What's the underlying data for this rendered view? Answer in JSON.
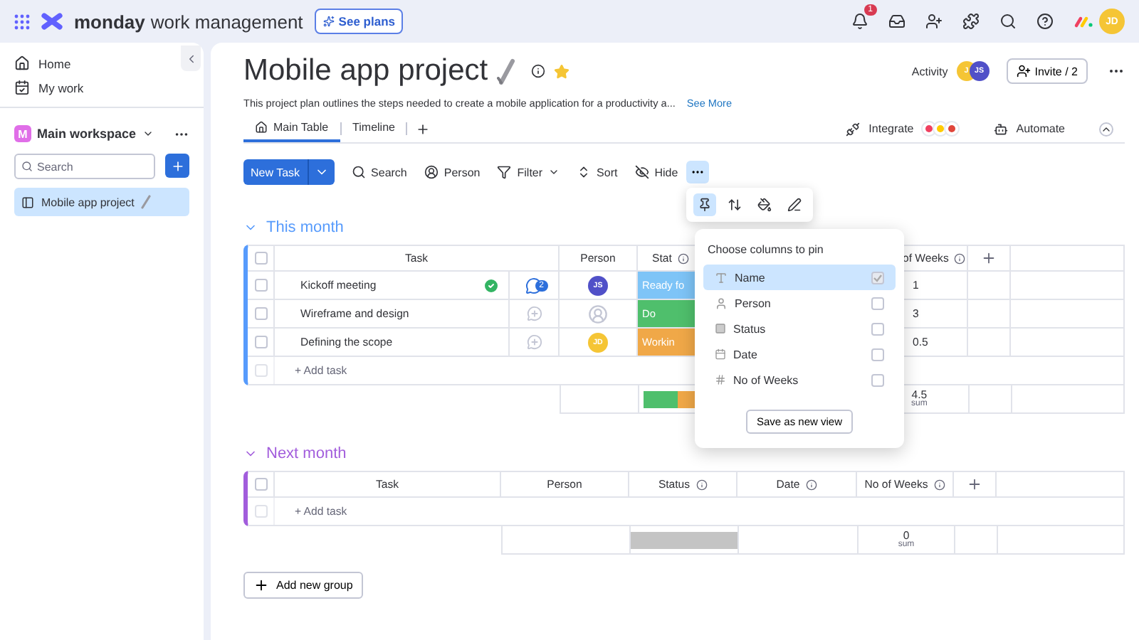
{
  "topbar": {
    "brand": "monday",
    "product": "work management",
    "see_plans": "See plans",
    "notification_count": "1",
    "avatar": "JD"
  },
  "sidebar": {
    "nav": [
      {
        "label": "Home",
        "kind": "home"
      },
      {
        "label": "My work",
        "kind": "work"
      }
    ],
    "workspace": {
      "badge": "M",
      "name": "Main workspace"
    },
    "search": {
      "placeholder": "Search"
    },
    "boards": [
      {
        "label": "Mobile app project",
        "selected": true
      }
    ]
  },
  "board": {
    "title": "Mobile app project",
    "description": "This project plan outlines the steps needed to create a mobile application for a productivity a...",
    "see_more": "See More",
    "activity": "Activity",
    "activity_avatars": [
      {
        "initials": "J",
        "color": "#f5c535"
      },
      {
        "initials": "JS",
        "color": "#5050c8"
      }
    ],
    "invite": "Invite / 2",
    "views": [
      {
        "label": "Main Table",
        "selected": true
      },
      {
        "label": "Timeline",
        "selected": false
      }
    ],
    "integrate": "Integrate",
    "automate": "Automate"
  },
  "toolbar": {
    "new_task": "New Task",
    "items": [
      {
        "label": "Search",
        "kind": "search"
      },
      {
        "label": "Person",
        "kind": "person"
      },
      {
        "label": "Filter",
        "kind": "filter"
      },
      {
        "label": "Sort",
        "kind": "sort"
      },
      {
        "label": "Hide",
        "kind": "hide"
      }
    ],
    "more_open": true
  },
  "groups": [
    {
      "title": "This month",
      "color": "#579bfc",
      "header_checked": false,
      "add_row_checked": false,
      "columns": {
        "task": "Task",
        "person": "Person",
        "status": "Stat",
        "weeks": "of Weeks"
      },
      "rows": [
        {
          "task": "Kickoff meeting",
          "checked": false,
          "done": true,
          "updates": "2",
          "person": {
            "initials": "JS",
            "color": "#5050c8"
          },
          "status": {
            "label": "Ready fo",
            "color": "#7ec4f7"
          },
          "weeks": "1"
        },
        {
          "task": "Wireframe and design",
          "checked": false,
          "done": false,
          "person": null,
          "status": {
            "label": "Do",
            "color": "#4fbf6c"
          },
          "weeks": "3"
        },
        {
          "task": "Defining the scope",
          "checked": false,
          "done": false,
          "person": {
            "initials": "JD",
            "color": "#f5c535"
          },
          "status": {
            "label": "Workin",
            "color": "#f0a848"
          },
          "weeks": "0.5"
        }
      ],
      "add_task": "+ Add task",
      "summary": {
        "segments": [
          {
            "color": "#4fbf6c"
          },
          {
            "color": "#f0a848"
          }
        ],
        "weeks": "4.5",
        "label": "sum"
      }
    },
    {
      "title": "Next month",
      "color": "#a25ddc",
      "header_checked": false,
      "add_row_checked": false,
      "columns": {
        "task": "Task",
        "person": "Person",
        "status": "Status",
        "date": "Date",
        "weeks": "No of Weeks"
      },
      "add_task": "+ Add task",
      "summary": {
        "segments": [
          {
            "color": "#c4c4c4"
          }
        ],
        "weeks": "0",
        "label": "sum"
      }
    }
  ],
  "add_group": "Add new group",
  "pin_tools": [
    {
      "kind": "pin",
      "selected": true
    },
    {
      "kind": "height",
      "selected": false
    },
    {
      "kind": "color",
      "selected": false
    },
    {
      "kind": "edit",
      "selected": false
    }
  ],
  "pin_menu": {
    "title": "Choose columns to pin",
    "items": [
      {
        "label": "Name",
        "kind": "text",
        "checked": true,
        "selected": true
      },
      {
        "label": "Person",
        "kind": "person",
        "checked": false,
        "selected": false
      },
      {
        "label": "Status",
        "kind": "status",
        "checked": false,
        "selected": false
      },
      {
        "label": "Date",
        "kind": "date",
        "checked": false,
        "selected": false
      },
      {
        "label": "No of Weeks",
        "kind": "number",
        "checked": false,
        "selected": false
      }
    ],
    "button": "Save as new view"
  }
}
